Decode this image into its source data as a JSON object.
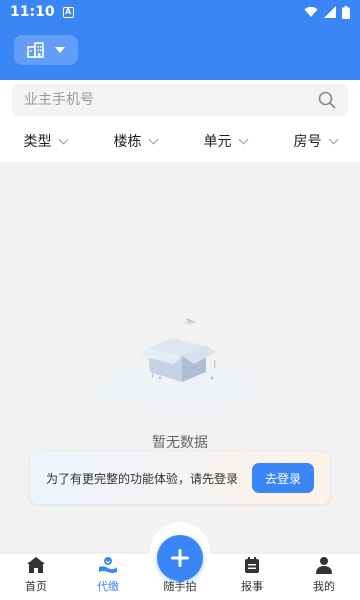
{
  "status_bar": {
    "time": "11:10",
    "notification_glyph": "A"
  },
  "header": {
    "community_icon": "building-icon",
    "dropdown_icon": "caret-down-icon"
  },
  "search": {
    "placeholder": "业主手机号",
    "value": "",
    "icon": "search-icon"
  },
  "filters": [
    {
      "label": "类型"
    },
    {
      "label": "楼栋"
    },
    {
      "label": "单元"
    },
    {
      "label": "房号"
    }
  ],
  "empty_state": {
    "text": "暂无数据",
    "illustration": "empty-box-illustration"
  },
  "login_banner": {
    "message": "为了有更完整的功能体验，请先登录",
    "button_label": "去登录"
  },
  "tabbar": {
    "items": [
      {
        "label": "首页",
        "icon": "home-icon",
        "active": false
      },
      {
        "label": "代缴",
        "icon": "payment-icon",
        "active": true
      },
      {
        "label": "随手拍",
        "icon": "plus-icon",
        "active": false
      },
      {
        "label": "报事",
        "icon": "report-icon",
        "active": false
      },
      {
        "label": "我的",
        "icon": "user-icon",
        "active": false
      }
    ]
  },
  "colors": {
    "primary": "#3b86f6",
    "background": "#f2f2f2",
    "text": "#222222",
    "muted": "#9a9a9a"
  }
}
